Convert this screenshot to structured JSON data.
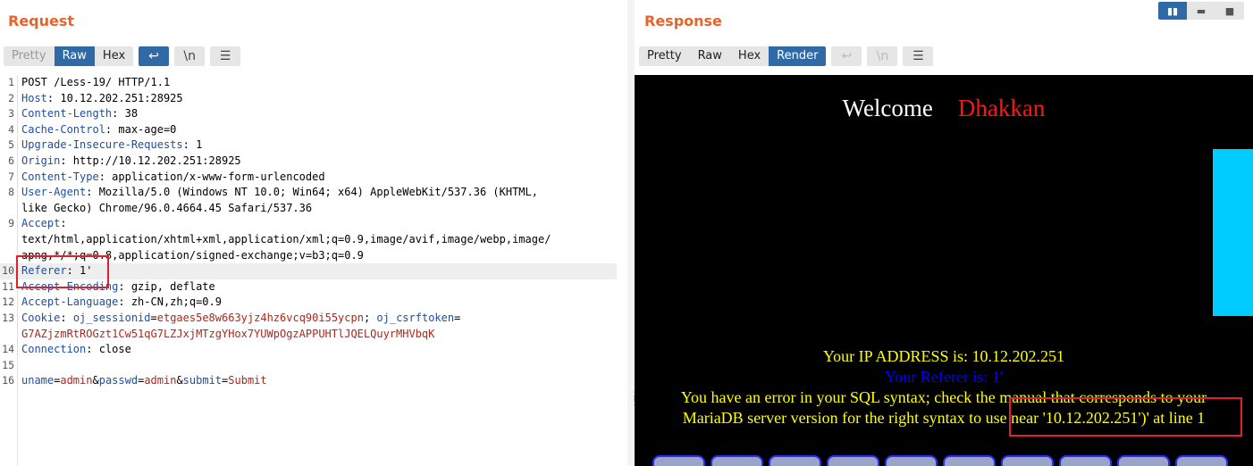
{
  "request": {
    "title": "Request",
    "tabs": [
      "Pretty",
      "Raw",
      "Hex"
    ],
    "active_tab": "Raw",
    "lines": [
      {
        "n": "1",
        "parts": [
          {
            "t": "POST /Less-19/ HTTP/1.1",
            "c": ""
          }
        ]
      },
      {
        "n": "2",
        "parts": [
          {
            "t": "Host",
            "c": "hk"
          },
          {
            "t": ": 10.12.202.251:28925",
            "c": ""
          }
        ]
      },
      {
        "n": "3",
        "parts": [
          {
            "t": "Content-Length",
            "c": "hk"
          },
          {
            "t": ": 38",
            "c": ""
          }
        ]
      },
      {
        "n": "4",
        "parts": [
          {
            "t": "Cache-Control",
            "c": "hk"
          },
          {
            "t": ": max-age=0",
            "c": ""
          }
        ]
      },
      {
        "n": "5",
        "parts": [
          {
            "t": "Upgrade-Insecure-Requests",
            "c": "hk"
          },
          {
            "t": ": 1",
            "c": ""
          }
        ]
      },
      {
        "n": "6",
        "parts": [
          {
            "t": "Origin",
            "c": "hk"
          },
          {
            "t": ": http://10.12.202.251:28925",
            "c": ""
          }
        ]
      },
      {
        "n": "7",
        "parts": [
          {
            "t": "Content-Type",
            "c": "hk"
          },
          {
            "t": ": application/x-www-form-urlencoded",
            "c": ""
          }
        ]
      },
      {
        "n": "8",
        "parts": [
          {
            "t": "User-Agent",
            "c": "hk"
          },
          {
            "t": ": Mozilla/5.0 (Windows NT 10.0; Win64; x64) AppleWebKit/537.36 (KHTML,",
            "c": ""
          }
        ]
      },
      {
        "n": "",
        "parts": [
          {
            "t": "like Gecko) Chrome/96.0.4664.45 Safari/537.36",
            "c": ""
          }
        ]
      },
      {
        "n": "9",
        "parts": [
          {
            "t": "Accept",
            "c": "hk"
          },
          {
            "t": ":",
            "c": ""
          }
        ]
      },
      {
        "n": "",
        "parts": [
          {
            "t": "text/html,application/xhtml+xml,application/xml;q=0.9,image/avif,image/webp,image/",
            "c": ""
          }
        ]
      },
      {
        "n": "",
        "parts": [
          {
            "t": "apng,*/*;q=0.8,application/signed-exchange;v=b3;q=0.9",
            "c": ""
          }
        ]
      },
      {
        "n": "10",
        "hl": true,
        "parts": [
          {
            "t": "Referer",
            "c": "hk"
          },
          {
            "t": ": 1'",
            "c": ""
          }
        ]
      },
      {
        "n": "11",
        "parts": [
          {
            "t": "Accept-Encoding",
            "c": "hk"
          },
          {
            "t": ": gzip, deflate",
            "c": ""
          }
        ]
      },
      {
        "n": "12",
        "parts": [
          {
            "t": "Accept-Language",
            "c": "hk"
          },
          {
            "t": ": zh-CN,zh;q=0.9",
            "c": ""
          }
        ]
      },
      {
        "n": "13",
        "parts": [
          {
            "t": "Cookie",
            "c": "hk"
          },
          {
            "t": ": ",
            "c": ""
          },
          {
            "t": "oj_sessionid",
            "c": "pn"
          },
          {
            "t": "=",
            "c": ""
          },
          {
            "t": "etgaes5e8w663yjz4hz6vcq90i55ycpn",
            "c": "pv"
          },
          {
            "t": "; ",
            "c": ""
          },
          {
            "t": "oj_csrftoken",
            "c": "pn"
          },
          {
            "t": "=",
            "c": ""
          }
        ]
      },
      {
        "n": "",
        "parts": [
          {
            "t": "G7AZjzmRtROGzt1Cw51qG7LZJxjMTzgYHox7YUWpOgzAPPUHTlJQELQuyrMHVbqK",
            "c": "pv"
          }
        ]
      },
      {
        "n": "14",
        "parts": [
          {
            "t": "Connection",
            "c": "hk"
          },
          {
            "t": ": close",
            "c": ""
          }
        ]
      },
      {
        "n": "15",
        "parts": [
          {
            "t": "",
            "c": ""
          }
        ]
      },
      {
        "n": "16",
        "parts": [
          {
            "t": "uname",
            "c": "pn"
          },
          {
            "t": "=",
            "c": ""
          },
          {
            "t": "admin",
            "c": "pv"
          },
          {
            "t": "&",
            "c": ""
          },
          {
            "t": "passwd",
            "c": "pn"
          },
          {
            "t": "=",
            "c": ""
          },
          {
            "t": "admin",
            "c": "pv"
          },
          {
            "t": "&",
            "c": ""
          },
          {
            "t": "submit",
            "c": "pn"
          },
          {
            "t": "=",
            "c": ""
          },
          {
            "t": "Submit",
            "c": "pv"
          }
        ]
      }
    ]
  },
  "response": {
    "title": "Response",
    "tabs": [
      "Pretty",
      "Raw",
      "Hex",
      "Render"
    ],
    "active_tab": "Render",
    "render": {
      "welcome": "Welcome",
      "name": "Dhakkan",
      "ip_line": "Your IP ADDRESS is: 10.12.202.251",
      "referer_line": "Your Referer is: 1'",
      "error_line_1": "You have an error in your SQL syntax; check the manual that corresponds to your",
      "error_line_2": "MariaDB server version for the right syntax to use near '10.12.202.251')' at line 1"
    }
  },
  "icons": {
    "wrap": "↩",
    "newline": "\\n",
    "menu": "☰"
  },
  "colors": {
    "accent": "#e8642c",
    "active_tab": "#2f6aa7",
    "highlight_box": "#e0202a"
  }
}
